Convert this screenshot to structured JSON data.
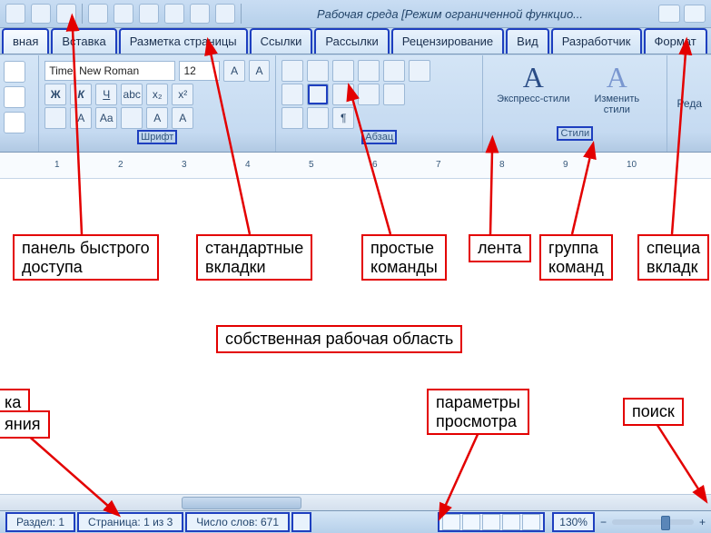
{
  "title": "Рабочая среда [Режим ограниченной функцио...",
  "tabs": [
    "вная",
    "Вставка",
    "Разметка страницы",
    "Ссылки",
    "Рассылки",
    "Рецензирование",
    "Вид",
    "Разработчик",
    "Формат"
  ],
  "font": {
    "name": "Time: New Roman",
    "size": "12"
  },
  "font_btns": {
    "bold": "Ж",
    "italic": "К",
    "under": "Ч",
    "strike": "abc",
    "sub": "x₂",
    "sup": "x²"
  },
  "groups": {
    "font": "Шрифт",
    "para": "Абзац",
    "styles": "Стили"
  },
  "styles": {
    "quick": "Экспресс-стили",
    "change": "Изменить\nстили"
  },
  "edit": "Реда",
  "ruler": [
    "1",
    "2",
    "3",
    "4",
    "5",
    "6",
    "7",
    "8",
    "9",
    "10"
  ],
  "status": {
    "section": "Раздел: 1",
    "page": "Страница: 1 из 3",
    "words": "Число слов: 671"
  },
  "zoom": "130%",
  "callouts": {
    "qat": "панель быстрого\nдоступа",
    "std_tabs": "стандартные\nвкладки",
    "simple_cmds": "простые\nкоманды",
    "ribbon": "лента",
    "cmd_group": "группа\nкоманд",
    "special_tabs": "специа\nвкладк",
    "work_area": "собственная рабочая область",
    "view_params": "параметры\nпросмотра",
    "search": "поиск",
    "ka": "ка",
    "state": "яния"
  }
}
